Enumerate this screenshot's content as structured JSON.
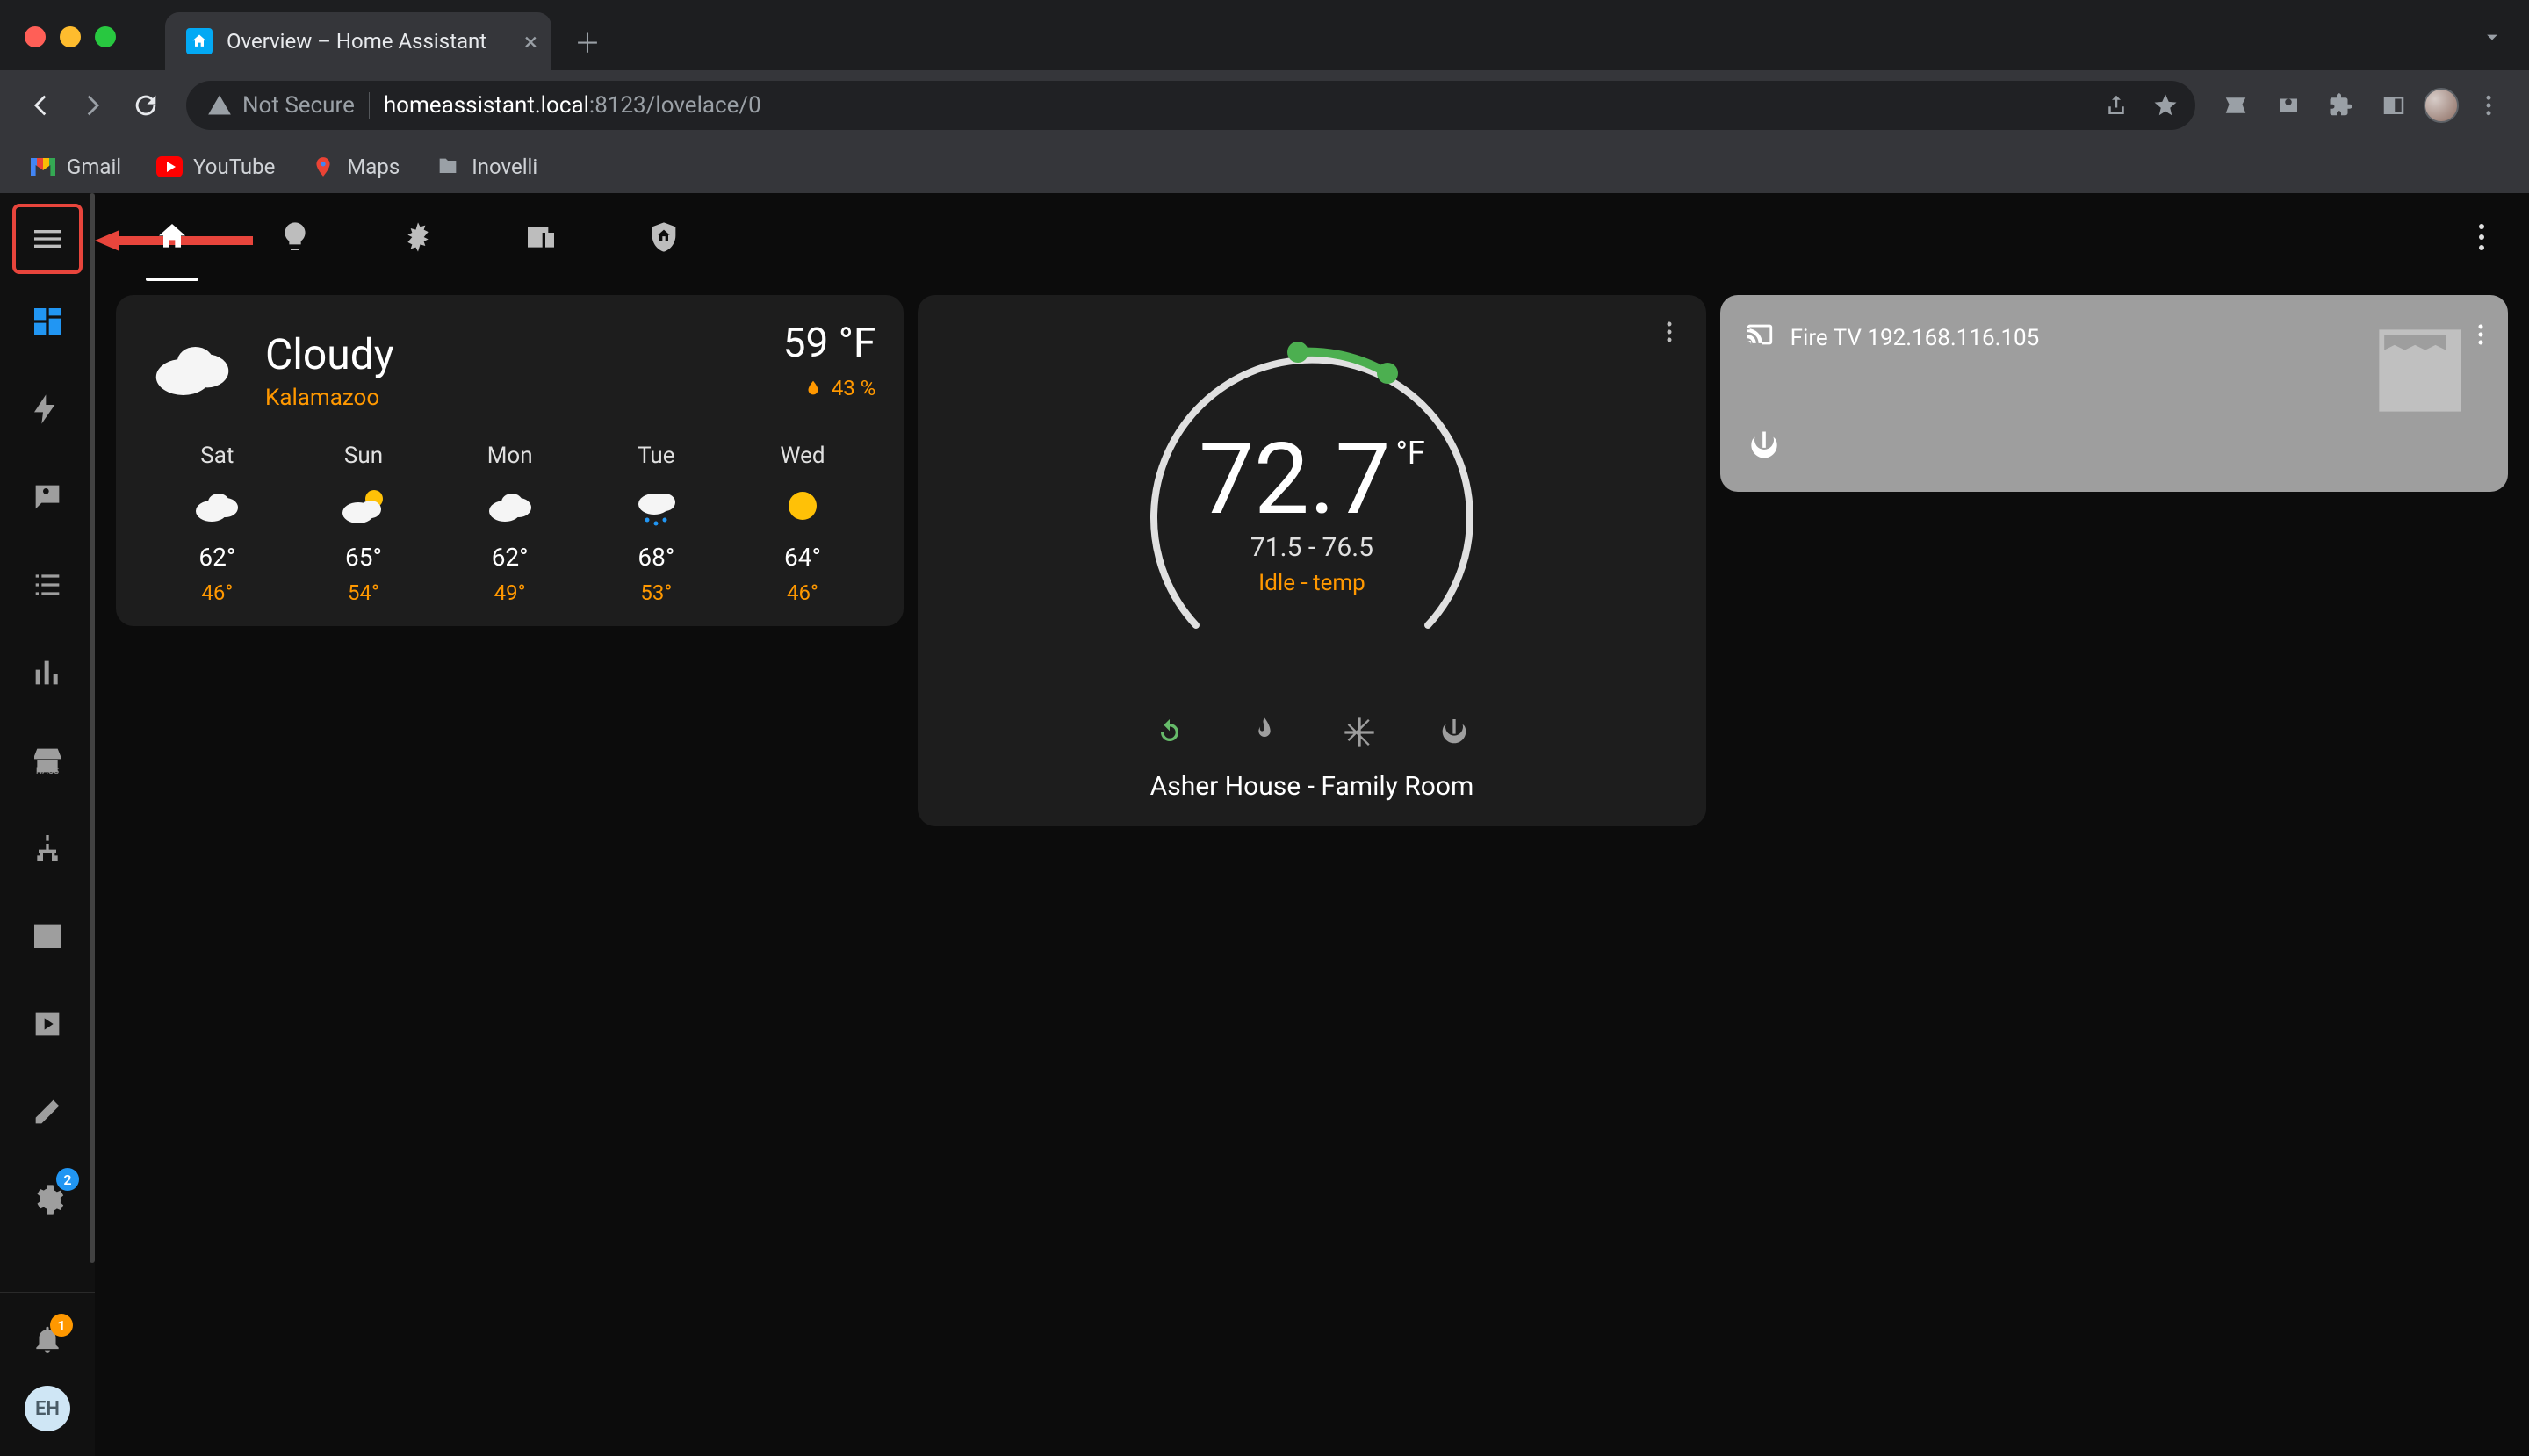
{
  "browser": {
    "tab_title": "Overview – Home Assistant",
    "url_security_label": "Not Secure",
    "url_domain": "homeassistant.local",
    "url_rest": ":8123/lovelace/0",
    "bookmarks": [
      {
        "label": "Gmail",
        "icon": "gmail"
      },
      {
        "label": "YouTube",
        "icon": "youtube"
      },
      {
        "label": "Maps",
        "icon": "maps"
      },
      {
        "label": "Inovelli",
        "icon": "folder"
      }
    ]
  },
  "sidebar": {
    "items": [
      {
        "name": "overview",
        "icon": "view-dashboard",
        "active": true
      },
      {
        "name": "energy",
        "icon": "lightning"
      },
      {
        "name": "people",
        "icon": "people-msg"
      },
      {
        "name": "todo",
        "icon": "list"
      },
      {
        "name": "history",
        "icon": "bar-chart"
      },
      {
        "name": "hacs",
        "icon": "store"
      },
      {
        "name": "devices",
        "icon": "network"
      },
      {
        "name": "terminal",
        "icon": "terminal"
      },
      {
        "name": "media",
        "icon": "play-box"
      },
      {
        "name": "devtools",
        "icon": "hammer"
      },
      {
        "name": "settings",
        "icon": "gear",
        "badge": "2"
      }
    ],
    "notifications_badge": "1",
    "user_initials": "EH"
  },
  "tabs": [
    {
      "name": "home",
      "icon": "home",
      "active": true
    },
    {
      "name": "lights",
      "icon": "lightbulb"
    },
    {
      "name": "climate",
      "icon": "snowflake"
    },
    {
      "name": "devices",
      "icon": "devices"
    },
    {
      "name": "security",
      "icon": "shield-home"
    }
  ],
  "weather": {
    "condition": "Cloudy",
    "location": "Kalamazoo",
    "temperature": "59 °F",
    "humidity": "43 %",
    "forecast": [
      {
        "day": "Sat",
        "icon": "cloudy",
        "high": "62°",
        "low": "46°"
      },
      {
        "day": "Sun",
        "icon": "partly-sunny",
        "high": "65°",
        "low": "54°"
      },
      {
        "day": "Mon",
        "icon": "cloudy",
        "high": "62°",
        "low": "49°"
      },
      {
        "day": "Tue",
        "icon": "rainy",
        "high": "68°",
        "low": "53°"
      },
      {
        "day": "Wed",
        "icon": "sunny",
        "high": "64°",
        "low": "46°"
      }
    ]
  },
  "thermostat": {
    "current": "72.7",
    "unit": "°F",
    "range": "71.5 - 76.5",
    "state": "Idle - temp",
    "name": "Asher House - Family Room",
    "modes": [
      {
        "name": "auto",
        "icon": "autorenew",
        "active": true
      },
      {
        "name": "heat",
        "icon": "fire"
      },
      {
        "name": "cool",
        "icon": "snowflake"
      },
      {
        "name": "off",
        "icon": "power"
      }
    ]
  },
  "media": {
    "title": "Fire TV 192.168.116.105"
  }
}
